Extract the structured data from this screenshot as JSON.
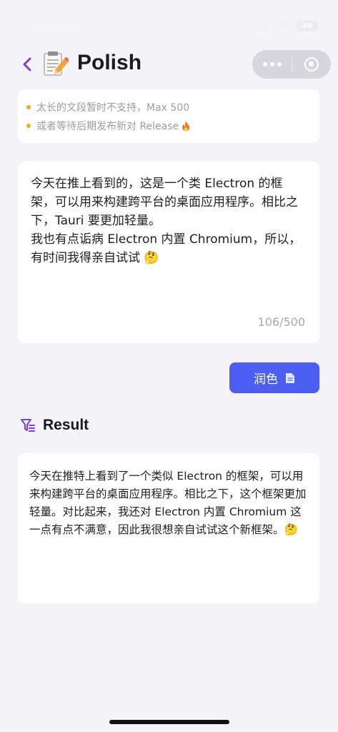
{
  "status_bar": {
    "time": "18:14",
    "battery": "20"
  },
  "nav": {
    "title": "Polish",
    "icons": {
      "back": "chevron-left-icon",
      "logo": "memo-pencil-icon",
      "more": "more-dots-icon",
      "close": "mini-program-close-icon"
    }
  },
  "notice": {
    "items": [
      {
        "text": "太长的文段暂时不支持，Max 500"
      },
      {
        "text": "或者等待后期发布新对 Release"
      }
    ]
  },
  "input": {
    "value": "今天在推上看到的，这是一个类 Electron 的框架，可以用来构建跨平台的桌面应用程序。相比之下，Tauri 要更加轻量。\n我也有点诟病 Electron 内置 Chromium，所以，有时间我得亲自试试 🤔",
    "char_count": "106/500"
  },
  "polish_button": {
    "label": "润色"
  },
  "result": {
    "title": "Result",
    "text": "今天在推特上看到了一个类似 Electron 的框架，可以用来构建跨平台的桌面应用程序。相比之下，这个框架更加轻量。对比起来，我还对 Electron 内置 Chromium 这一点有点不满意，因此我很想亲自试试这个新框架。🤔"
  },
  "colors": {
    "accent": "#4b5ef1",
    "back_arrow": "#7b3fd6",
    "notice_dot": "#f0a62a",
    "background": "#f4f3f8"
  }
}
